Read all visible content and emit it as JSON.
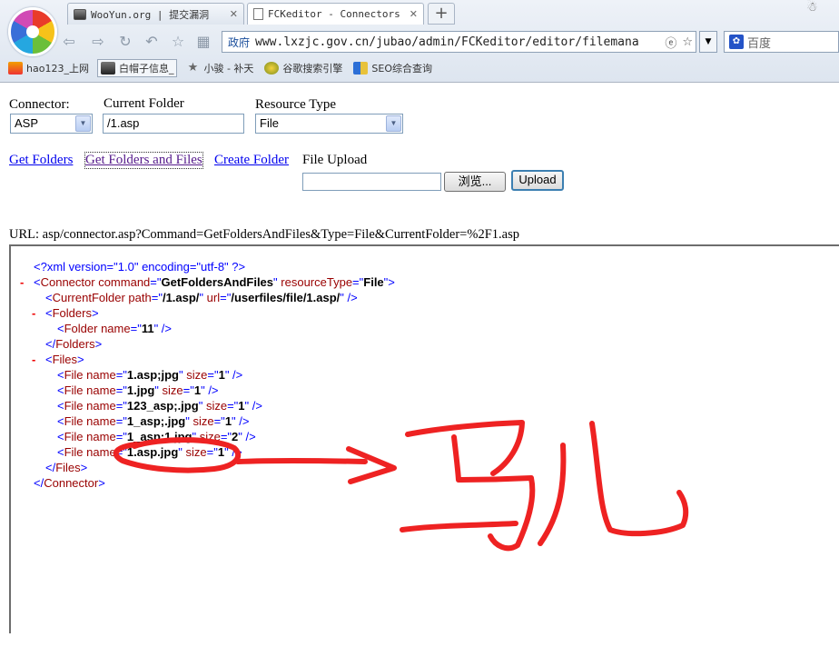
{
  "browser": {
    "tabs": [
      {
        "title": "WooYun.org | 提交漏洞",
        "close": "✕",
        "active": false
      },
      {
        "title": "FCKeditor - Connectors Te",
        "close": "✕",
        "active": true
      }
    ],
    "new_tab": "+",
    "address": {
      "zone": "政府",
      "url": "www.lxzjc.gov.cn/jubao/admin/FCKeditor/editor/filemana"
    },
    "search_placeholder": "百度",
    "bookmarks": [
      {
        "label": "hao123_上网"
      },
      {
        "label": "白帽子信息_"
      },
      {
        "label": "小骏 - 补天"
      },
      {
        "label": "谷歌搜索引擎"
      },
      {
        "label": "SEO综合查询"
      }
    ]
  },
  "form": {
    "connector_label": "Connector:",
    "connector_value": "ASP",
    "current_folder_label": "Current Folder",
    "current_folder_value": "/1.asp",
    "resource_type_label": "Resource Type",
    "resource_type_value": "File",
    "links": {
      "get_folders": "Get Folders",
      "get_folders_and_files": "Get Folders and Files",
      "create_folder": "Create Folder"
    },
    "file_upload_label": "File Upload",
    "browse_button": "浏览...",
    "upload_button": "Upload"
  },
  "request_url": "URL: asp/connector.asp?Command=GetFoldersAndFiles&Type=File&CurrentFolder=%2F1.asp",
  "xml": {
    "declaration": "<?xml version=\"1.0\" encoding=\"utf-8\" ?>",
    "minus": "-",
    "connector": {
      "command": "GetFoldersAndFiles",
      "resourceType": "File"
    },
    "current_folder": {
      "path": "/1.asp/",
      "url": "/userfiles/file/1.asp/"
    },
    "folders": [
      {
        "name": "11"
      }
    ],
    "files": [
      {
        "name": "1.asp;jpg",
        "size": "1"
      },
      {
        "name": "1.jpg",
        "size": "1"
      },
      {
        "name": "123_asp;.jpg",
        "size": "1"
      },
      {
        "name": "1_asp;.jpg",
        "size": "1"
      },
      {
        "name": "1_asp;1.jpg",
        "size": "2"
      },
      {
        "name": "1.asp.jpg",
        "size": "1"
      }
    ]
  },
  "annotation": {
    "color": "#ee2222",
    "handwritten_text": "马儿"
  }
}
